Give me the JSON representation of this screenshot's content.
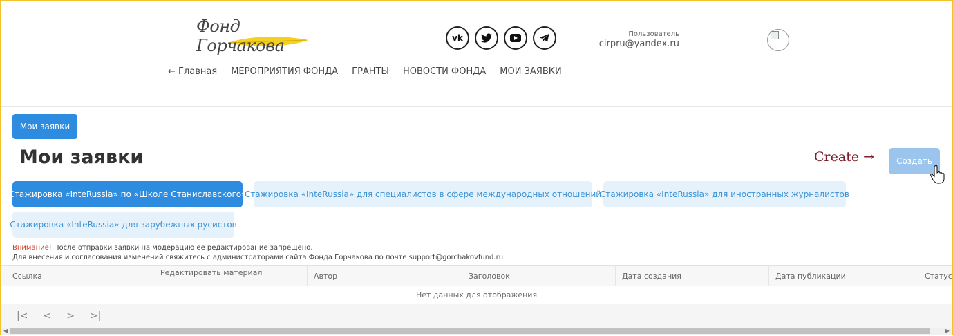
{
  "header": {
    "logo_text": "Фонд Горчакова",
    "socials": [
      {
        "icon": "vk-icon",
        "glyph": "vk"
      },
      {
        "icon": "twitter-icon",
        "glyph": "🐦"
      },
      {
        "icon": "youtube-icon",
        "glyph": "▶"
      },
      {
        "icon": "telegram-icon",
        "glyph": "➤"
      }
    ],
    "user_caption": "Пользователь",
    "user_email": "cirpru@yandex.ru",
    "nav": [
      "← Главная",
      "МЕРОПРИЯТИЯ ФОНДА",
      "ГРАНТЫ",
      "НОВОСТИ ФОНДА",
      "МОИ ЗАЯВКИ"
    ]
  },
  "breadcrumb": "Мои заявки",
  "page_title": "Мои заявки",
  "create_annotation": "Create →",
  "create_button": "Создать",
  "tabs": [
    {
      "label": "Стажировка «InteRussia» по «Школе Станиславского»",
      "active": true
    },
    {
      "label": "Стажировка «InteRussia» для специалистов в сфере международных отношений",
      "active": false
    },
    {
      "label": "Стажировка «InteRussia» для иностранных журналистов",
      "active": false
    },
    {
      "label": "Стажировка «InteRussia» для зарубежных русистов",
      "active": false
    }
  ],
  "notice": {
    "warn": "Внимание!",
    "line1": " После отправки заявки на модерацию ее редактирование запрещено.",
    "line2": "Для внесения и согласования изменений свяжитесь с администраторами сайта Фонда Горчакова по почте support@gorchakovfund.ru"
  },
  "table": {
    "columns": [
      "Ссылка",
      "Редактировать материал",
      "Автор",
      "Заголовок",
      "Дата создания",
      "Дата публикации",
      "Статус"
    ],
    "empty_text": "Нет данных для отображения"
  },
  "pager": [
    "|<",
    "<",
    ">",
    ">|"
  ],
  "colors": {
    "accent": "#2d8be0",
    "accent_light": "#e6f2fb",
    "frame": "#f2c230",
    "warn": "#d23f2a"
  }
}
